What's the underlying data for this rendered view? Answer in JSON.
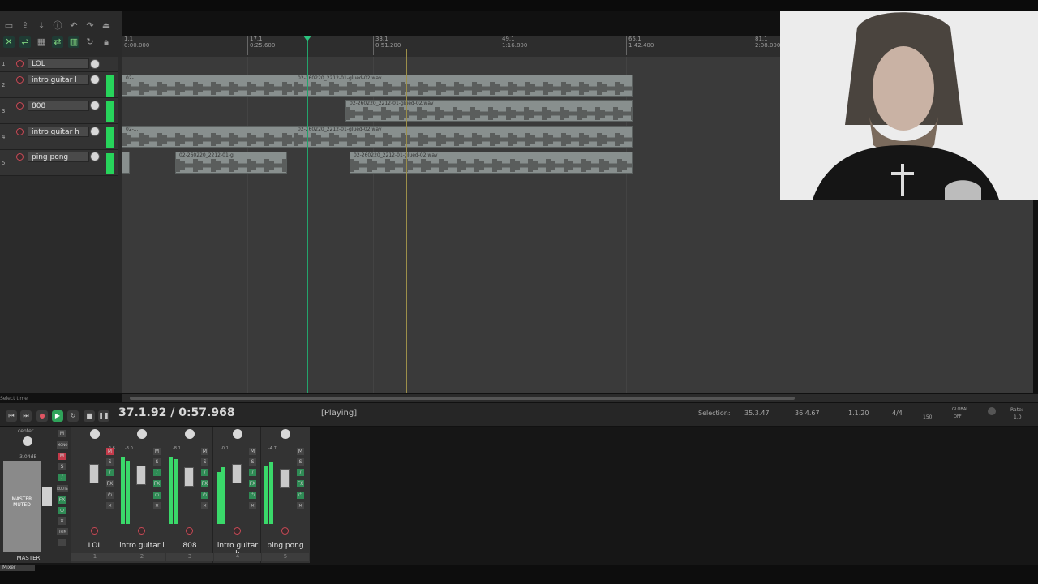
{
  "ruler": {
    "marks": [
      {
        "bar": "1.1",
        "time": "0:00.000"
      },
      {
        "bar": "17.1",
        "time": "0:25.600"
      },
      {
        "bar": "33.1",
        "time": "0:51.200"
      },
      {
        "bar": "49.1",
        "time": "1:16.800"
      },
      {
        "bar": "65.1",
        "time": "1:42.400"
      },
      {
        "bar": "81.1",
        "time": "2:08.000"
      }
    ]
  },
  "tracks": [
    {
      "num": "1",
      "name": "LOL"
    },
    {
      "num": "2",
      "name": "intro guitar l"
    },
    {
      "num": "3",
      "name": "808"
    },
    {
      "num": "4",
      "name": "intro guitar h"
    },
    {
      "num": "5",
      "name": "ping pong"
    }
  ],
  "items": {
    "glued_a": "02-260220_2212-01-glued-02.wav",
    "glued_b": "02-260220_2212-01-glued-02.wav",
    "short_a": "02-...",
    "short_b": "02-260220_2212-01-gl"
  },
  "transport": {
    "position": "37.1.92 / 0:57.968",
    "status": "[Playing]",
    "selection_label": "Selection:",
    "selection_start": "35.3.47",
    "selection_end": "36.4.67",
    "selection_length": "1.1.20",
    "time_signature": "4/4",
    "tempo": "150",
    "global": "GLOBAL",
    "global_off": "OFF",
    "rate_label": "Rate:",
    "rate_value": "1.0",
    "select_hint": "Select time"
  },
  "mixer": {
    "master_label": "MASTER",
    "master_state": "MASTER\nMUTED",
    "master_pan": "center",
    "master_vol": "-3.04dB",
    "mono": "MONO",
    "route": "ROUTE",
    "trim": "TRIM",
    "strips": [
      {
        "name": "LOL",
        "num": "1",
        "db": "-2.6"
      },
      {
        "name": "intro guitar l",
        "num": "2",
        "db": "-3.0"
      },
      {
        "name": "808",
        "num": "3",
        "db": "-8.1"
      },
      {
        "name": "intro guitar h",
        "num": "4",
        "db": "-0.1"
      },
      {
        "name": "ping pong",
        "num": "5",
        "db": "-4.7"
      }
    ],
    "tab_label": "Mixer"
  },
  "colors": {
    "accent_green": "#27d45b",
    "record_red": "#c94a56",
    "item_gray": "#888f8e"
  }
}
